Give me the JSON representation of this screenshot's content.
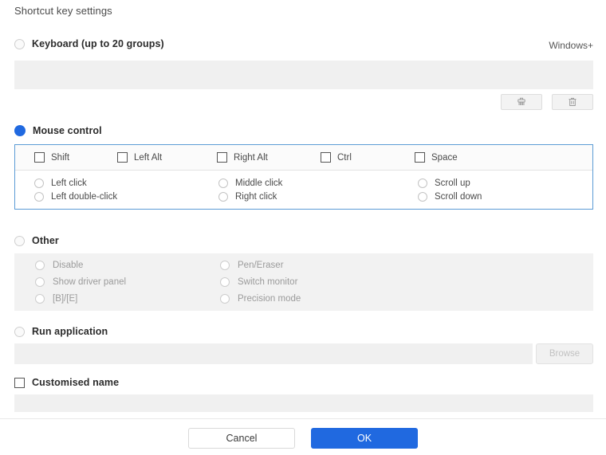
{
  "dialog": {
    "title": "Shortcut key settings"
  },
  "keyboard": {
    "label": "Keyboard (up to 20 groups)",
    "modifier_hint": "Windows+",
    "input_value": "",
    "selected": false,
    "clear_icon": "brush-icon",
    "delete_icon": "trash-icon"
  },
  "mouse_control": {
    "label": "Mouse control",
    "selected": true,
    "modifiers": [
      {
        "label": "Shift",
        "checked": false
      },
      {
        "label": "Left Alt",
        "checked": false
      },
      {
        "label": "Right Alt",
        "checked": false
      },
      {
        "label": "Ctrl",
        "checked": false
      },
      {
        "label": "Space",
        "checked": false
      }
    ],
    "actions_columns": [
      [
        {
          "label": "Left click",
          "selected": false
        },
        {
          "label": "Left double-click",
          "selected": false
        }
      ],
      [
        {
          "label": "Middle click",
          "selected": false
        },
        {
          "label": "Right click",
          "selected": false
        }
      ],
      [
        {
          "label": "Scroll up",
          "selected": false
        },
        {
          "label": "Scroll down",
          "selected": false
        }
      ]
    ]
  },
  "other": {
    "label": "Other",
    "selected": false,
    "columns": [
      [
        {
          "label": "Disable",
          "selected": false
        },
        {
          "label": "Show driver panel",
          "selected": false
        },
        {
          "label": "[B]/[E]",
          "selected": false
        }
      ],
      [
        {
          "label": "Pen/Eraser",
          "selected": false
        },
        {
          "label": "Switch monitor",
          "selected": false
        },
        {
          "label": "Precision mode",
          "selected": false
        }
      ]
    ]
  },
  "run_application": {
    "label": "Run application",
    "selected": false,
    "path_value": "",
    "browse_label": "Browse"
  },
  "customised_name": {
    "label": "Customised name",
    "checked": false,
    "input_value": ""
  },
  "footer": {
    "cancel_label": "Cancel",
    "ok_label": "OK"
  },
  "colors": {
    "accent": "#2069e0",
    "panel_border": "#5b9bd5",
    "field_bg": "#f0f0f0",
    "disabled_text": "#9b9b9b"
  }
}
